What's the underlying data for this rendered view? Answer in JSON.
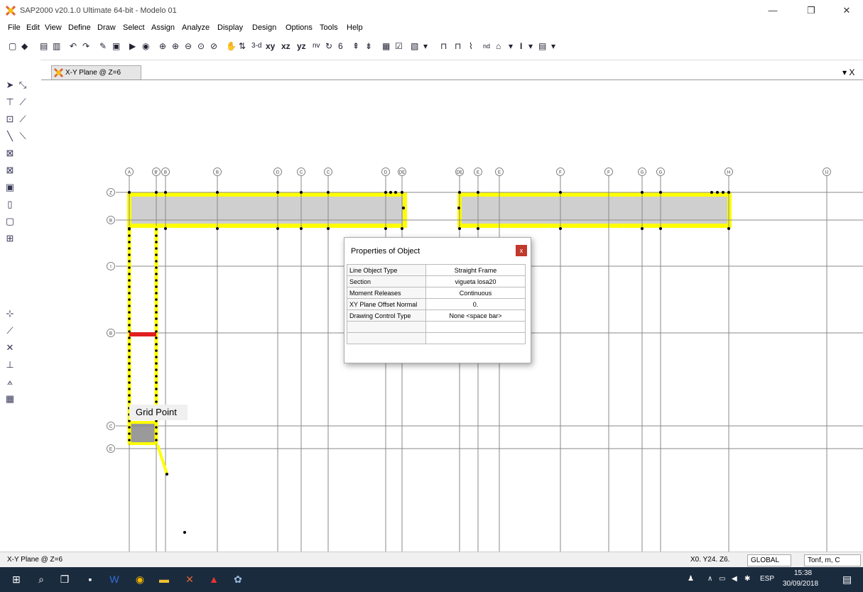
{
  "window": {
    "title": "SAP2000 v20.1.0 Ultimate 64-bit - Modelo 01",
    "icon": "sap2000-logo-icon",
    "min": "—",
    "restore": "❐",
    "close": "✕"
  },
  "menu": [
    "File",
    "Edit",
    "View",
    "Define",
    "Draw",
    "Select",
    "Assign",
    "Analyze",
    "Display",
    "Design",
    "Options",
    "Tools",
    "Help"
  ],
  "toolbar": {
    "view_3d": "3-d",
    "view_xy": "xy",
    "view_xz": "xz",
    "view_yz": "yz",
    "view_nv": "nv",
    "nd": "nd"
  },
  "tab": {
    "label": "X-Y Plane @ Z=6",
    "close": "▾ X"
  },
  "grid": {
    "x_labels": [
      "A",
      "B'",
      "B",
      "B",
      "D",
      "C",
      "C",
      "D",
      "DE",
      "DE",
      "E",
      "E",
      "F",
      "F",
      "G",
      "G",
      "H",
      "IJ"
    ],
    "y_labels": [
      "Z",
      "B",
      "I",
      "B",
      "C",
      "E"
    ]
  },
  "tooltip": {
    "text": "Grid Point"
  },
  "dialog": {
    "title": "Properties of Object",
    "close": "x",
    "rows": [
      {
        "key": "Line Object Type",
        "value": "Straight Frame"
      },
      {
        "key": "Section",
        "value": "vigueta losa20"
      },
      {
        "key": "Moment Releases",
        "value": "Continuous"
      },
      {
        "key": "XY Plane Offset Normal",
        "value": "0."
      },
      {
        "key": "Drawing Control Type",
        "value": "None  <space bar>"
      },
      {
        "key": "",
        "value": ""
      },
      {
        "key": "",
        "value": ""
      }
    ]
  },
  "status": {
    "view": "X-Y Plane @ Z=6",
    "coords": "X0. Y24. Z6.",
    "csys": "GLOBAL",
    "units": "Tonf, m, C"
  },
  "taskbar": {
    "lang": "ESP",
    "time": "15:38",
    "date": "30/09/2018"
  },
  "colors": {
    "highlight": "#ffff00",
    "release": "#e02020",
    "slab": "#cfcfcf",
    "taskbar": "#1b2b3e"
  }
}
